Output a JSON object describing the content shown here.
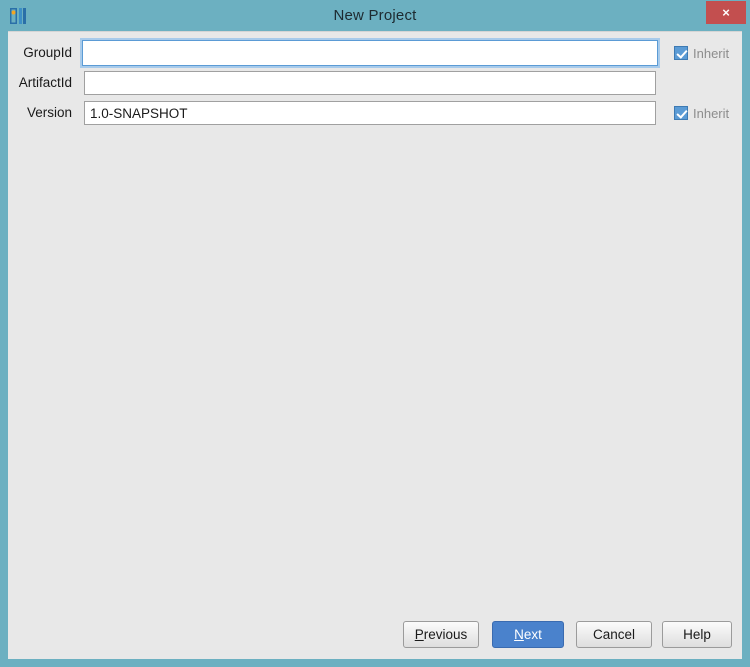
{
  "window": {
    "title": "New Project",
    "icon_name": "intellij-idea-logo",
    "close_label": "×",
    "frame_color": "#6cb0c1",
    "panel_color": "#e8e8e8"
  },
  "form": {
    "fields": [
      {
        "label": "GroupId",
        "value": "",
        "placeholder": "",
        "focused": true,
        "has_inherit": true,
        "inherit_label": "Inherit",
        "inherit_checked": true
      },
      {
        "label": "ArtifactId",
        "value": "",
        "placeholder": "",
        "focused": false,
        "has_inherit": false,
        "inherit_label": "",
        "inherit_checked": false
      },
      {
        "label": "Version",
        "value": "1.0-SNAPSHOT",
        "placeholder": "",
        "focused": false,
        "has_inherit": true,
        "inherit_label": "Inherit",
        "inherit_checked": true
      }
    ]
  },
  "buttons": {
    "previous": {
      "mnemonic": "P",
      "rest": "revious"
    },
    "next": {
      "mnemonic": "N",
      "rest": "ext"
    },
    "cancel": {
      "label": "Cancel"
    },
    "help": {
      "label": "Help"
    }
  },
  "colors": {
    "titlebar": "#6cb0c1",
    "close": "#c34f4f",
    "primary_button": "#4a82cc",
    "checkbox": "#5b9bd5",
    "focus_ring": "#a8cbeb"
  }
}
